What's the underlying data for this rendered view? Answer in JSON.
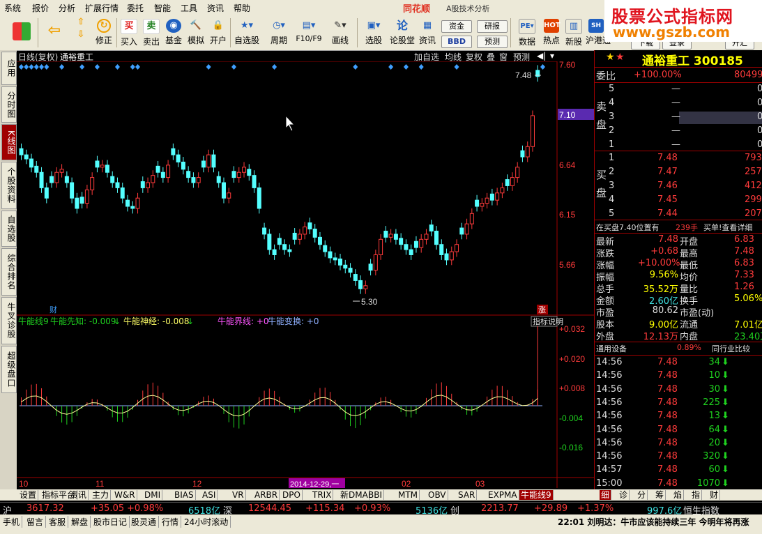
{
  "menu": {
    "items": [
      "系统",
      "报价",
      "分析",
      "扩展行情",
      "委托",
      "智能",
      "工具",
      "资讯",
      "帮助"
    ],
    "brand": "同花顺",
    "title": "A股技术分析"
  },
  "watermark": {
    "line1": "股票公式指标网",
    "line2": "www.gszb.com"
  },
  "toolbar": {
    "buttons": [
      "修正",
      "买入",
      "卖出",
      "基金",
      "模拟",
      "开户",
      "自选股",
      "周期",
      "F10/F9",
      "画线",
      "选股",
      "论股堂",
      "资讯",
      "数据",
      "热点",
      "新股",
      "沪港通"
    ],
    "small_buttons": [
      "资金",
      "研报",
      "BBD",
      "预测"
    ],
    "top_buttons": [
      "下载",
      "登录",
      "开汇"
    ]
  },
  "leftnav": {
    "items": [
      "应用",
      "分时图",
      "K线图",
      "个股资料",
      "自选股",
      "综合排名",
      "牛叉诊股",
      "超级盘口"
    ]
  },
  "chart": {
    "header_left": "日线(复权)",
    "stock_name": "通裕重工",
    "header_buttons": [
      "加自选",
      "均线",
      "复权",
      "叠",
      "窗",
      "预测"
    ],
    "price_labels": [
      "7.60",
      "7.10",
      "6.64",
      "6.15",
      "5.66"
    ],
    "current_price_tag": "7.10",
    "max_label": "7.48",
    "min_label": "5.30",
    "fin_marker": "财",
    "zhang_marker": "涨",
    "indicator_name": "牛能线9",
    "indicator_items": [
      {
        "label": "牛能先知: -0.009",
        "color": "#1fd11f"
      },
      {
        "label": "牛能神经: -0.008",
        "color": "#ffff66"
      },
      {
        "label": "牛能界线: +0",
        "color": "#ff55ff"
      },
      {
        "label": "牛能变换: +0",
        "color": "#8fb0ff"
      }
    ],
    "indicator_button": "指标说明",
    "indicator_labels": [
      "+0.032",
      "+0.020",
      "+0.008",
      "-0.004",
      "-0.016"
    ],
    "date_labels": [
      "10",
      "11",
      "12",
      "2014-12-29,一",
      "02",
      "03"
    ]
  },
  "right": {
    "stock_title": "通裕重工 300185",
    "weibi_label": "委比",
    "weibi_value": "+100.00%",
    "weibi_extra": "80499",
    "sell_label": "卖盘",
    "sell": [
      {
        "n": "5",
        "p": "—",
        "v": "0"
      },
      {
        "n": "4",
        "p": "—",
        "v": "0"
      },
      {
        "n": "3",
        "p": "—",
        "v": "0"
      },
      {
        "n": "2",
        "p": "—",
        "v": "0"
      },
      {
        "n": "1",
        "p": "—",
        "v": "0"
      }
    ],
    "buy_label": "买盘",
    "buy": [
      {
        "n": "1",
        "p": "7.48",
        "v": "79324"
      },
      {
        "n": "2",
        "p": "7.47",
        "v": "257"
      },
      {
        "n": "3",
        "p": "7.46",
        "v": "412"
      },
      {
        "n": "4",
        "p": "7.45",
        "v": "299"
      },
      {
        "n": "5",
        "p": "7.44",
        "v": "207"
      }
    ],
    "queue_text": "在买盘7.40位置有",
    "queue_qty": "239手",
    "queue_link": "买单!查看详细",
    "quote": [
      {
        "l1": "最新",
        "v1": "7.48",
        "c1": "red",
        "l2": "开盘",
        "v2": "6.83",
        "c2": "red"
      },
      {
        "l1": "涨跌",
        "v1": "+0.68",
        "c1": "red",
        "l2": "最高",
        "v2": "7.48",
        "c2": "red"
      },
      {
        "l1": "涨幅",
        "v1": "+10.00%",
        "c1": "red",
        "l2": "最低",
        "v2": "6.83",
        "c2": "red"
      },
      {
        "l1": "振幅",
        "v1": "9.56%",
        "c1": "yel",
        "l2": "均价",
        "v2": "7.33",
        "c2": "red"
      },
      {
        "l1": "总手",
        "v1": "35.52万",
        "c1": "yel",
        "l2": "量比",
        "v2": "1.26",
        "c2": "red"
      },
      {
        "l1": "金额",
        "v1": "2.60亿",
        "c1": "cyn",
        "l2": "换手",
        "v2": "5.06%",
        "c2": "yel"
      },
      {
        "l1": "市盈",
        "v1": "80.62",
        "c1": "wht",
        "l2": "市盈(动)",
        "v2": "",
        "c2": "wht"
      },
      {
        "l1": "股本",
        "v1": "9.00亿",
        "c1": "yel",
        "l2": "流通",
        "v2": "7.01亿",
        "c2": "yel"
      },
      {
        "l1": "外盘",
        "v1": "12.13万",
        "c1": "red",
        "l2": "内盘",
        "v2": "23.40万",
        "c2": "grn"
      }
    ],
    "industry_label": "通用设备",
    "industry_pct": "0.89%",
    "industry_button": "同行业比较",
    "ticks": [
      {
        "t": "14:56",
        "p": "7.48",
        "v": "34"
      },
      {
        "t": "14:56",
        "p": "7.48",
        "v": "10"
      },
      {
        "t": "14:56",
        "p": "7.48",
        "v": "30"
      },
      {
        "t": "14:56",
        "p": "7.48",
        "v": "225"
      },
      {
        "t": "14:56",
        "p": "7.48",
        "v": "13"
      },
      {
        "t": "14:56",
        "p": "7.48",
        "v": "64"
      },
      {
        "t": "14:56",
        "p": "7.48",
        "v": "20"
      },
      {
        "t": "14:56",
        "p": "7.48",
        "v": "320"
      },
      {
        "t": "14:57",
        "p": "7.48",
        "v": "60"
      },
      {
        "t": "15:00",
        "p": "7.48",
        "v": "1070"
      }
    ],
    "bottom_tabs": [
      "细",
      "诊",
      "分",
      "筹",
      "焰",
      "指",
      "财"
    ]
  },
  "tabs": [
    "设置",
    "指标平台",
    "资讯",
    "主力",
    "W&R",
    "DMI",
    "BIAS",
    "ASI",
    "VR",
    "ARBR",
    "DPO",
    "TRIX",
    "新DMA",
    "BBI",
    "MTM",
    "OBV",
    "SAR",
    "EXPMA",
    "牛能线9"
  ],
  "indexbar": {
    "sh_label": "沪",
    "sh_val": "3617.32",
    "sh_chg": "+35.05",
    "sh_pct": "+0.98%",
    "sh_amt": "6518亿",
    "sz_label": "深",
    "sz_val": "12544.45",
    "sz_chg": "+115.34",
    "sz_pct": "+0.93%",
    "sz_amt": "5136亿",
    "cy_label": "创",
    "cy_val": "2213.77",
    "cy_chg": "+29.89",
    "cy_pct": "+1.37%",
    "cy_amt": "997.6亿",
    "hs_label": "恒生指数"
  },
  "statusbar": {
    "items": [
      "手机",
      "留言",
      "客服",
      "解盘",
      "股市日记",
      "股灵通",
      "行情",
      "24小时滚动"
    ],
    "ticker": "22:01 刘明达：牛市应该能持续三年 今明年将再涨"
  },
  "colors": {
    "up": "#ff3b3b",
    "down": "#54ffff",
    "bg": "#000000",
    "axis": "#a00000",
    "accent": "#a00000"
  }
}
